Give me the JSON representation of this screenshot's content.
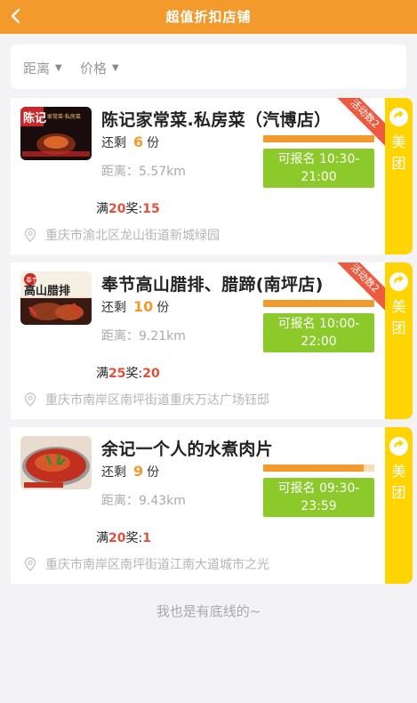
{
  "header": {
    "title": "超值折扣店铺",
    "back_icon": "chevron-left-icon"
  },
  "filters": [
    {
      "label": "距离"
    },
    {
      "label": "价格"
    }
  ],
  "stores": [
    {
      "name": "陈记家常菜.私房菜（汽博店）",
      "remain_label": "还剩",
      "remain_count": "6",
      "remain_unit": "份",
      "distance": "距离：5.57km",
      "reward_prefix": "满",
      "reward_threshold": "20",
      "reward_mid": "奖:",
      "reward_amount": "15",
      "address": "重庆市渝北区龙山街道新城绿园",
      "signup_label": "可报名 10:30-21:00",
      "progress": 1.0,
      "badge": "活动数2",
      "tuan_label": "美团",
      "thumb_colors": [
        "#1a0c0c",
        "#c8282a"
      ]
    },
    {
      "name": "奉节高山腊排、腊蹄(南坪店)",
      "remain_label": "还剩",
      "remain_count": "10",
      "remain_unit": "份",
      "distance": "距离：9.21km",
      "reward_prefix": "满",
      "reward_threshold": "25",
      "reward_mid": "奖:",
      "reward_amount": "20",
      "address": "重庆市南岸区南坪街道重庆万达广场钰邸",
      "signup_label": "可报名 10:00-22:00",
      "progress": 1.0,
      "badge": "活动数2",
      "tuan_label": "美团",
      "thumb_colors": [
        "#3a1a10",
        "#d23a28"
      ]
    },
    {
      "name": "余记一个人的水煮肉片",
      "remain_label": "还剩",
      "remain_count": "9",
      "remain_unit": "份",
      "distance": "距离：9.43km",
      "reward_prefix": "满",
      "reward_threshold": "20",
      "reward_mid": "奖:",
      "reward_amount": "1",
      "address": "重庆市南岸区南坪街道江南大道城市之光",
      "signup_label": "可报名 09:30-23:59",
      "progress": 0.9,
      "badge": "",
      "tuan_label": "美团",
      "thumb_colors": [
        "#e8dccf",
        "#c1301f"
      ]
    }
  ],
  "footer": {
    "text": "我也是有底线的~"
  },
  "colors": {
    "accent": "#f39a2c",
    "green": "#8cc92b",
    "yellow": "#ffd400",
    "red": "#e0513a"
  }
}
